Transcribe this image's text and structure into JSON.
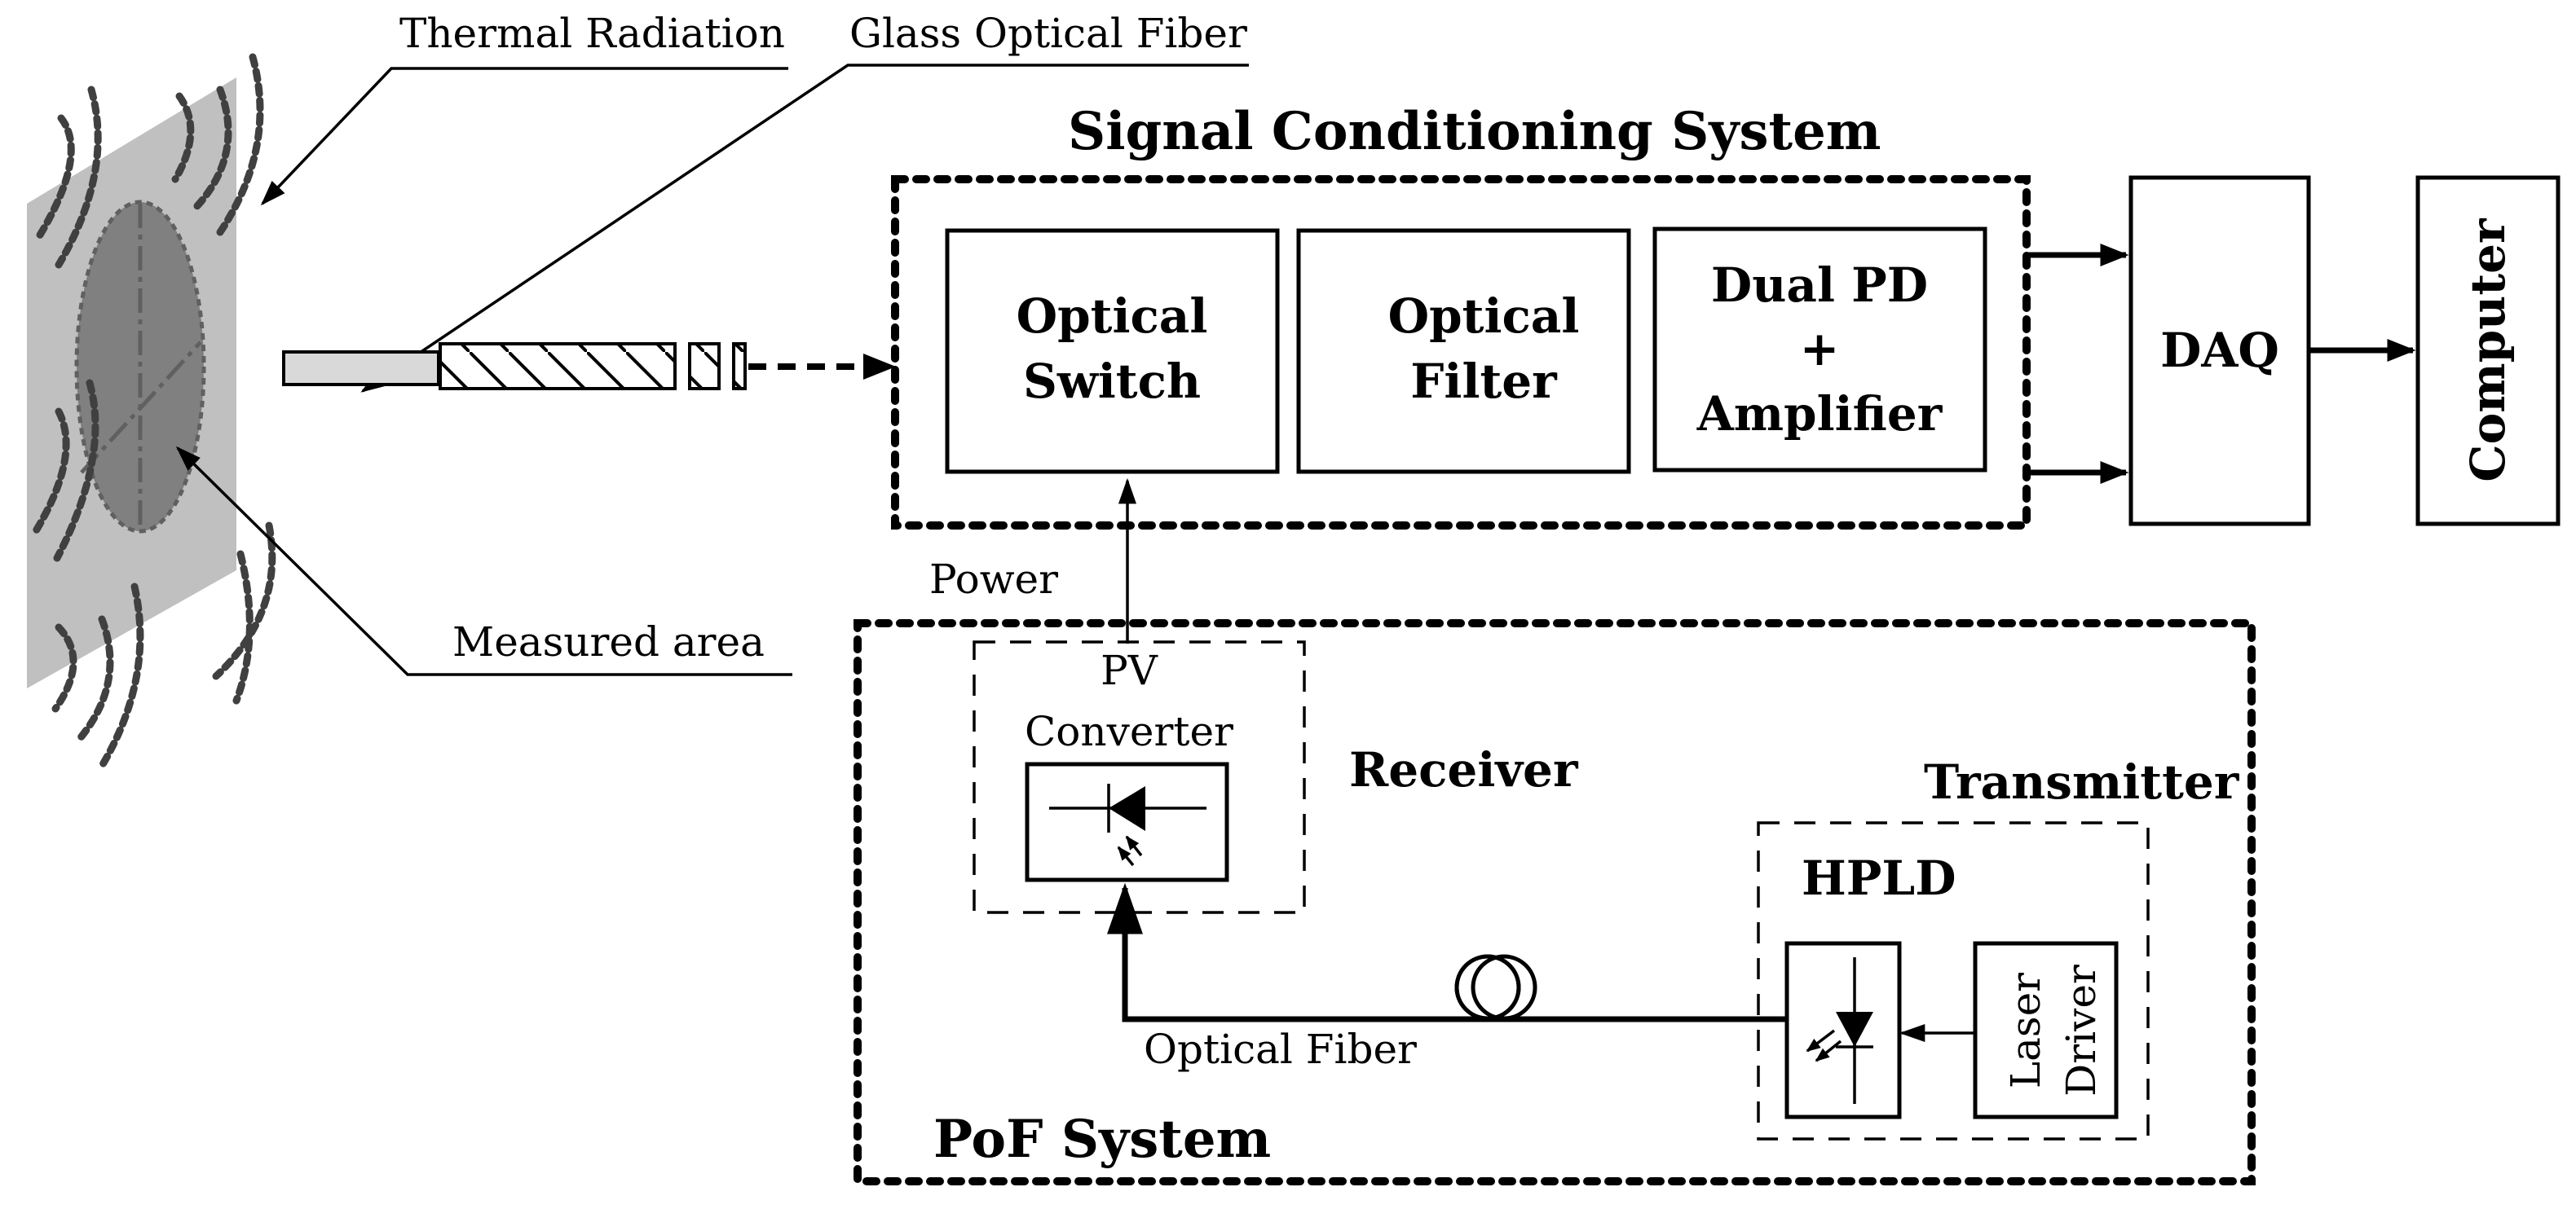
{
  "labels": {
    "thermal_radiation": "Thermal Radiation",
    "glass_optical_fiber": "Glass Optical Fiber",
    "measured_area": "Measured area",
    "signal_conditioning_system": "Signal Conditioning System",
    "optical_switch_line1": "Optical",
    "optical_switch_line2": "Switch",
    "optical_filter_line1": "Optical",
    "optical_filter_line2": "Filter",
    "dual_pd_line1": "Dual PD",
    "dual_pd_line2": "+",
    "dual_pd_line3": "Amplifier",
    "daq": "DAQ",
    "computer": "Computer",
    "power": "Power",
    "pv_converter_line1": "PV",
    "pv_converter_line2": "Converter",
    "receiver": "Receiver",
    "transmitter": "Transmitter",
    "hpld": "HPLD",
    "laser_driver_line1": "Laser",
    "laser_driver_line2": "Driver",
    "optical_fiber": "Optical Fiber",
    "pof_system": "PoF System"
  },
  "colors": {
    "plane": "#c0c0c0",
    "measured_area": "#808080",
    "fiber_fill": "#d9d9d9",
    "stroke": "#000000"
  }
}
